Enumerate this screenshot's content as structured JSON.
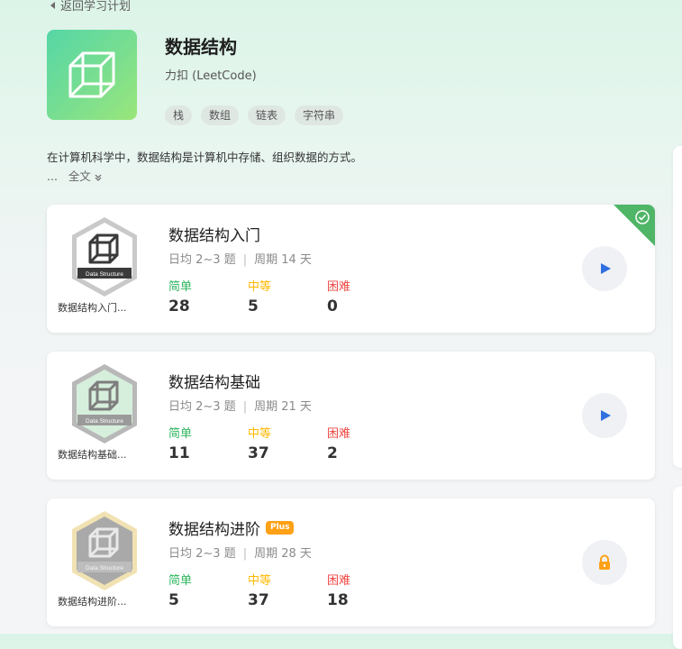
{
  "nav": {
    "back_label": "返回学习计划"
  },
  "plan": {
    "title": "数据结构",
    "author": "力扣 (LeetCode)",
    "tags": [
      "栈",
      "数组",
      "链表",
      "字符串"
    ],
    "description": "在计算机科学中，数据结构是计算机中存储、组织数据的方式。",
    "ellipsis": "...",
    "expand_label": "全文"
  },
  "labels": {
    "easy": "简单",
    "medium": "中等",
    "hard": "困难",
    "separator": "|"
  },
  "courses": [
    {
      "name": "数据结构入门",
      "badge_label": "数据结构入门...",
      "badge_text": "Data Structure",
      "daily": "日均 2~3 题",
      "period": "周期 14 天",
      "easy": "28",
      "medium": "5",
      "hard": "0",
      "completed": true,
      "plus": false,
      "action_icon": "play-icon",
      "badge_color": "#3a3a3a"
    },
    {
      "name": "数据结构基础",
      "badge_label": "数据结构基础...",
      "badge_text": "Data Structure",
      "daily": "日均 2~3 题",
      "period": "周期 21 天",
      "easy": "11",
      "medium": "37",
      "hard": "2",
      "completed": false,
      "plus": false,
      "action_icon": "play-icon",
      "badge_color": "#8f8f8f"
    },
    {
      "name": "数据结构进阶",
      "badge_label": "数据结构进阶...",
      "badge_text": "Data Structure",
      "plus_label": "Plus",
      "daily": "日均 2~3 题",
      "period": "周期 28 天",
      "easy": "5",
      "medium": "37",
      "hard": "18",
      "completed": false,
      "plus": true,
      "action_icon": "lock-icon",
      "badge_color": "#a8a8a8"
    }
  ],
  "colors": {
    "easy": "#2db55d",
    "medium": "#ffb800",
    "hard": "#ef4743",
    "accent": "#2f6fe0",
    "plus": "#ffa116",
    "completed": "#4fb567"
  }
}
